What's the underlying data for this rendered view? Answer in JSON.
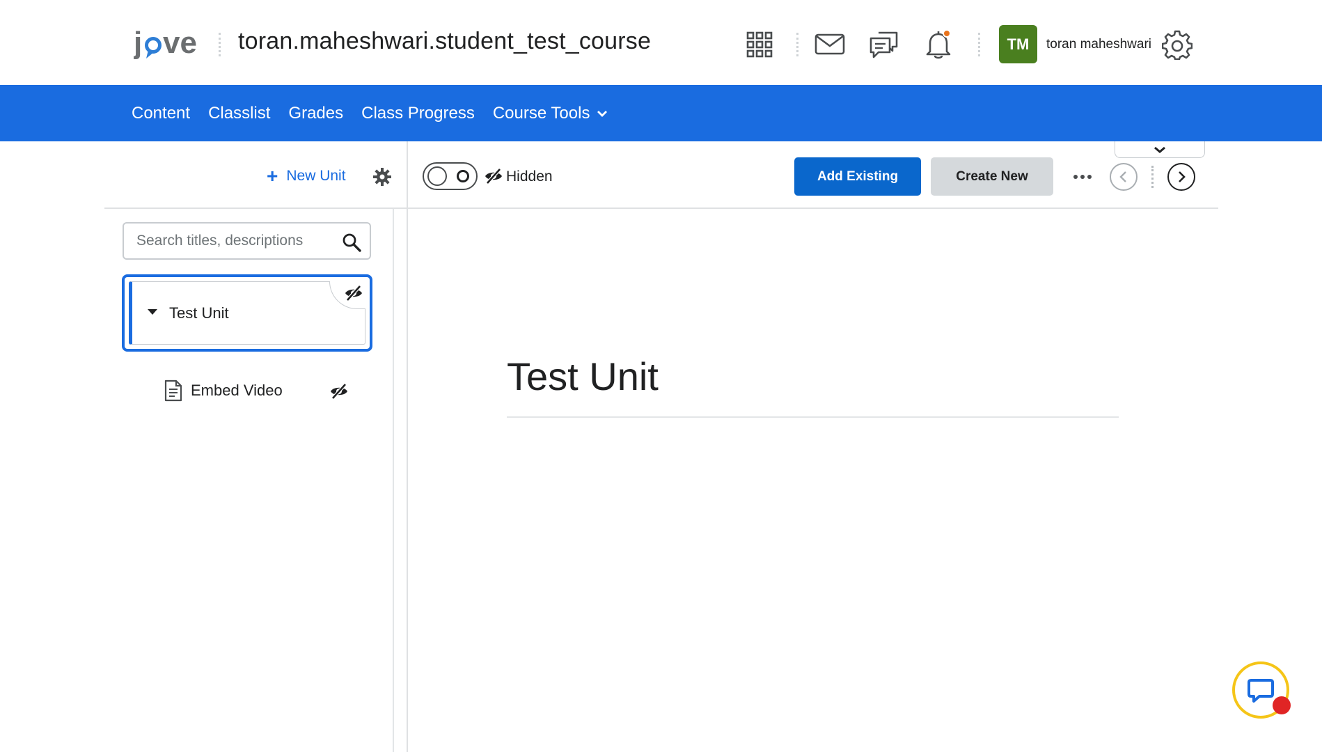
{
  "header": {
    "logo_alt": "jove",
    "course_title": "toran.maheshwari.student_test_course",
    "icons": [
      "apps-grid-icon",
      "mail-icon",
      "chat-bubbles-icon",
      "bell-icon",
      "gear-icon"
    ],
    "user": {
      "initials": "TM",
      "name": "toran maheshwari",
      "avatar_color": "#4a7f1f"
    },
    "notification_dot_color": "#e8731c"
  },
  "nav": {
    "bg_color": "#1a6ce0",
    "items": [
      {
        "label": "Content"
      },
      {
        "label": "Classlist"
      },
      {
        "label": "Grades"
      },
      {
        "label": "Class Progress"
      },
      {
        "label": "Course Tools",
        "has_dropdown": true
      }
    ]
  },
  "left_panel": {
    "new_unit_label": "New Unit",
    "search_placeholder": "Search titles, descriptions",
    "search_value": "",
    "units": [
      {
        "title": "Test Unit",
        "selected": true,
        "hidden": true,
        "expanded": true
      }
    ],
    "items": [
      {
        "title": "Embed Video",
        "icon": "document-icon",
        "hidden": true
      }
    ]
  },
  "toolbar": {
    "visibility_label": "Hidden",
    "add_existing_label": "Add Existing",
    "create_new_label": "Create New",
    "accent_color": "#0a67cc"
  },
  "content": {
    "title": "Test Unit"
  }
}
